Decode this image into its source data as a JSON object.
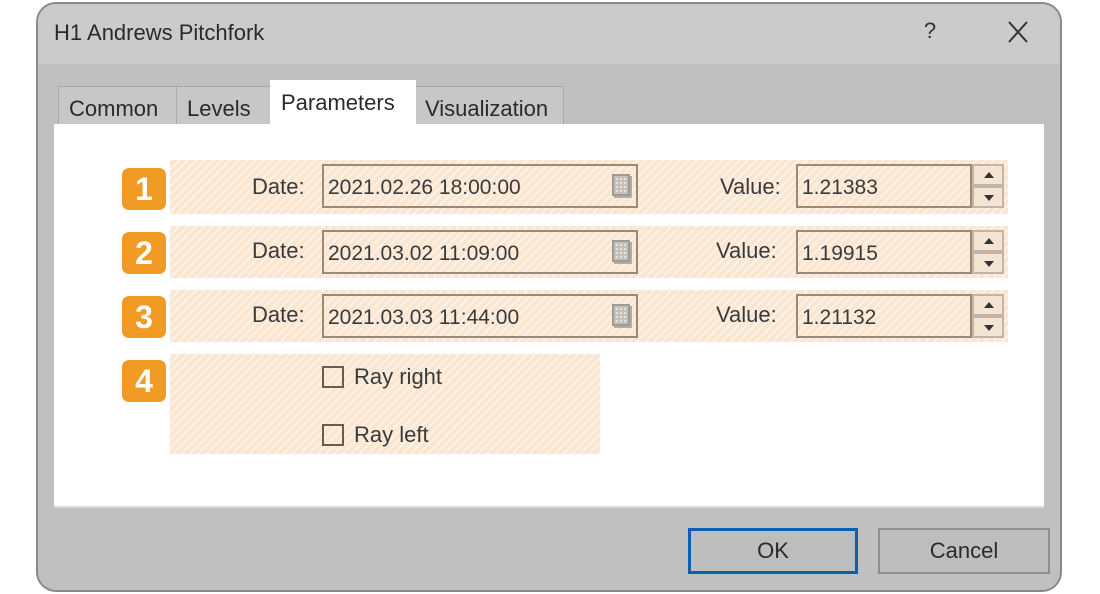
{
  "window": {
    "title": "H1 Andrews Pitchfork",
    "help_label": "?",
    "close_icon": "close-icon"
  },
  "tabs": [
    {
      "label": "Common",
      "active": false
    },
    {
      "label": "Levels",
      "active": false
    },
    {
      "label": "Parameters",
      "active": true
    },
    {
      "label": "Visualization",
      "active": false
    }
  ],
  "parameters": {
    "points": [
      {
        "badge": "1",
        "date_label": "Date:",
        "date_value": "2021.02.26 18:00:00",
        "value_label": "Value:",
        "value": "1.21383"
      },
      {
        "badge": "2",
        "date_label": "Date:",
        "date_value": "2021.03.02 11:09:00",
        "value_label": "Value:",
        "value": "1.19915"
      },
      {
        "badge": "3",
        "date_label": "Date:",
        "date_value": "2021.03.03 11:44:00",
        "value_label": "Value:",
        "value": "1.21132"
      }
    ],
    "options_badge": "4",
    "options": [
      {
        "label": "Ray right",
        "checked": false
      },
      {
        "label": "Ray left",
        "checked": false
      }
    ]
  },
  "buttons": {
    "ok": "OK",
    "cancel": "Cancel"
  },
  "colors": {
    "badge": "#f19a24",
    "highlight": "#fbe6d2",
    "focus_border": "#0b5fae"
  }
}
